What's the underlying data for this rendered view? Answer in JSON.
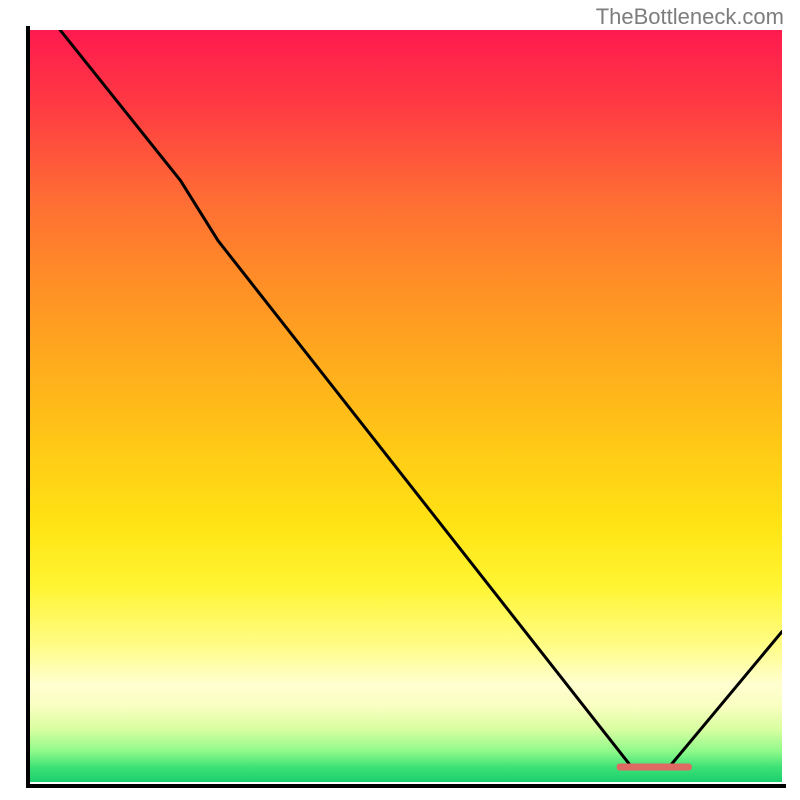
{
  "watermark": "TheBottleneck.com",
  "chart_data": {
    "type": "line",
    "title": "",
    "xlabel": "",
    "ylabel": "",
    "x_range": [
      0,
      100
    ],
    "y_range": [
      0,
      100
    ],
    "curve": [
      {
        "x": 4,
        "y": 100
      },
      {
        "x": 20,
        "y": 80
      },
      {
        "x": 25,
        "y": 72
      },
      {
        "x": 80,
        "y": 2
      },
      {
        "x": 85,
        "y": 2
      },
      {
        "x": 100,
        "y": 20
      }
    ],
    "optimum_segment": {
      "x_start": 78,
      "x_end": 88,
      "y": 2
    },
    "background_gradient": {
      "stops": [
        {
          "pos": 0.0,
          "color": "#ff1a4f"
        },
        {
          "pos": 0.5,
          "color": "#ffc816"
        },
        {
          "pos": 0.85,
          "color": "#fffdc0"
        },
        {
          "pos": 1.0,
          "color": "#1bcf6d"
        }
      ]
    }
  }
}
